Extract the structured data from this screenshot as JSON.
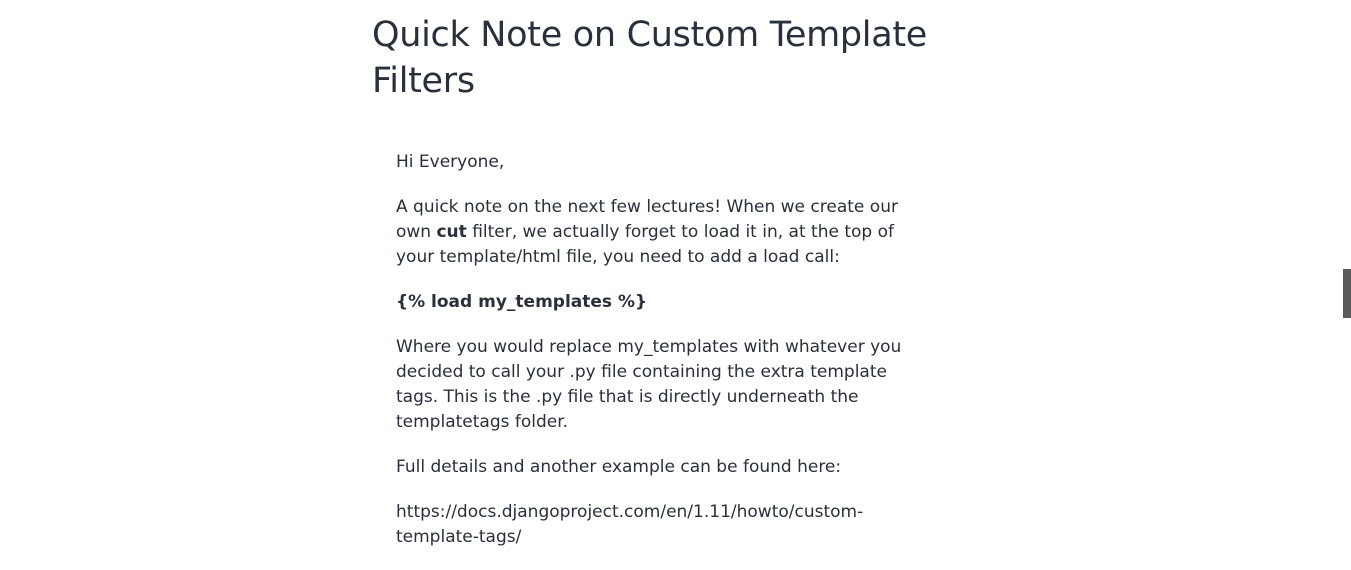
{
  "lecture": {
    "title": "Quick Note on Custom Template Filters"
  },
  "article": {
    "greeting": "Hi Everyone,",
    "para1_before": "A quick note on the next few lectures! When we create our own ",
    "para1_bold": "cut",
    "para1_after": " filter, we actually forget to load it in, at the top of your template/html file, you need to add a load call:",
    "code_line": "{% load my_templates %}",
    "para2": "Where you would replace my_templates with whatever you decided to call your .py file containing the extra template tags. This is the .py file that is directly underneath the templatetags folder.",
    "para3": "Full details and another example can be found here:",
    "link": "https://docs.djangoproject.com/en/1.11/howto/custom-template-tags/"
  },
  "colors": {
    "text": "#29303b",
    "scrollbar": "#5a5a5a"
  }
}
